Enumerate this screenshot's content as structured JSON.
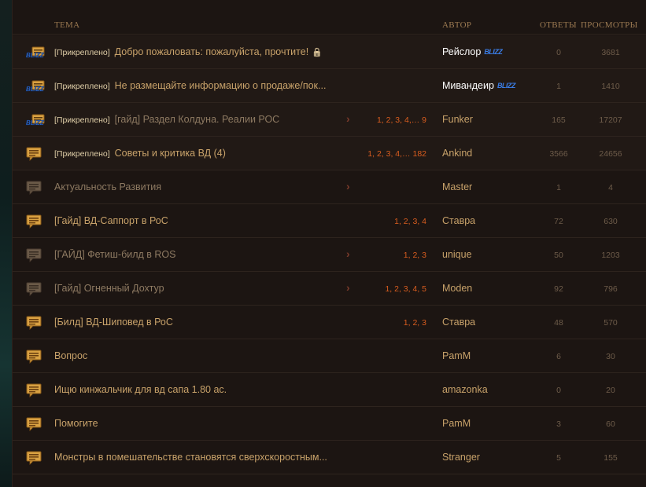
{
  "header": {
    "topic": "ТЕМА",
    "author": "АВТОР",
    "replies": "ОТВЕТЫ",
    "views": "ПРОСМОТРЫ"
  },
  "colors": {
    "accent": "#d95d1f",
    "title_text": "#c8a26a",
    "blizzard_blue": "#3a7de6"
  },
  "rows": [
    {
      "pinned": "[Прикреплено]",
      "title": "Добро пожаловать: пожалуйста, прочтите!",
      "pages": "",
      "author": "Рейслор",
      "blz": "BLIZZ",
      "replies": "0",
      "views": "3681",
      "icon": "blizzard-post-icon"
    },
    {
      "pinned": "[Прикреплено]",
      "title": "Не размещайте информацию о продаже/пок...",
      "pages": "",
      "author": "Мивандеир",
      "blz": "BLIZZ",
      "replies": "1",
      "views": "1410",
      "icon": "blizzard-post-icon"
    },
    {
      "pinned": "[Прикреплено]",
      "title": "[гайд] Раздел Колдуна. Реалии РОС",
      "pages": "1, 2, 3, 4,… 9",
      "author": "Funker",
      "blz": "",
      "replies": "165",
      "views": "17207",
      "icon": "blizzard-post-icon"
    },
    {
      "pinned": "[Прикреплено]",
      "title": "Советы и критика ВД (4)",
      "pages": "1, 2, 3, 4,… 182",
      "author": "Ankind",
      "blz": "",
      "replies": "3566",
      "views": "24656",
      "icon": "chat-bubble-icon"
    },
    {
      "pinned": "",
      "title": "Актуальность Развития",
      "pages": "",
      "author": "Master",
      "blz": "",
      "replies": "1",
      "views": "4",
      "icon": "chat-bubble-icon"
    },
    {
      "pinned": "",
      "title": "[Гайд] ВД-Саппорт в РоС",
      "pages": "1, 2, 3, 4",
      "author": "Ставра",
      "blz": "",
      "replies": "72",
      "views": "630",
      "icon": "chat-bubble-icon"
    },
    {
      "pinned": "",
      "title": "[ГАЙД] Фетиш-билд в ROS",
      "pages": "1, 2, 3",
      "author": "unique",
      "blz": "",
      "replies": "50",
      "views": "1203",
      "icon": "chat-bubble-icon"
    },
    {
      "pinned": "",
      "title": "[Гайд] Огненный Дохтур",
      "pages": "1, 2, 3, 4, 5",
      "author": "Moden",
      "blz": "",
      "replies": "92",
      "views": "796",
      "icon": "chat-bubble-icon"
    },
    {
      "pinned": "",
      "title": "[Билд] ВД-Шиповед в РоС",
      "pages": "1, 2, 3",
      "author": "Ставра",
      "blz": "",
      "replies": "48",
      "views": "570",
      "icon": "chat-bubble-icon"
    },
    {
      "pinned": "",
      "title": "Вопрос",
      "pages": "",
      "author": "PamM",
      "blz": "",
      "replies": "6",
      "views": "30",
      "icon": "chat-bubble-icon"
    },
    {
      "pinned": "",
      "title": "Ищю кинжальчик для вд сапа 1.80 ас.",
      "pages": "",
      "author": "amazonka",
      "blz": "",
      "replies": "0",
      "views": "20",
      "icon": "chat-bubble-icon"
    },
    {
      "pinned": "",
      "title": "Помогите",
      "pages": "",
      "author": "PamM",
      "blz": "",
      "replies": "3",
      "views": "60",
      "icon": "chat-bubble-icon"
    },
    {
      "pinned": "",
      "title": "Монстры в помешательстве становятся сверхскоростным...",
      "pages": "",
      "author": "Stranger",
      "blz": "",
      "replies": "5",
      "views": "155",
      "icon": "chat-bubble-icon"
    }
  ]
}
